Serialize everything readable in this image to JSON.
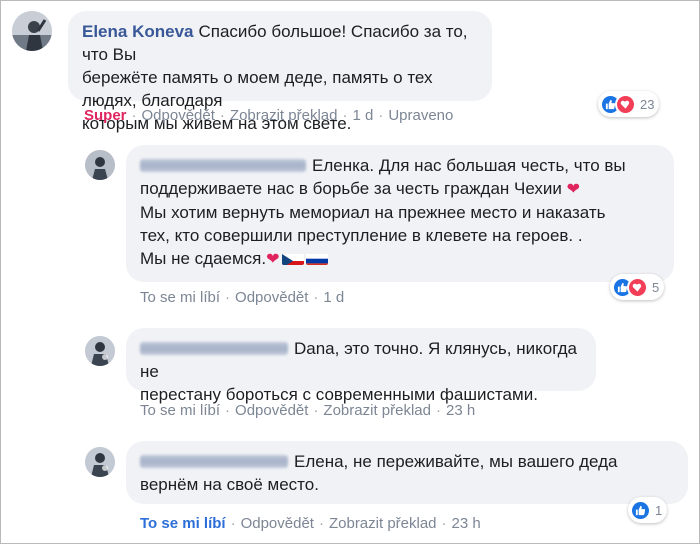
{
  "comments": [
    {
      "author": "Elena Koneva",
      "text_lines": [
        "Спасибо большое! Спасибо за то, что Вы",
        "бережёте память о моем деде, память о тех людях, благодаря",
        "которым мы живем на этом свете."
      ],
      "actions": [
        "Super",
        "Odpovědět",
        "Zobrazit překlad",
        "1 d",
        "Upraveno"
      ],
      "reactions": {
        "count": "23",
        "types": [
          "like-icon",
          "love-icon"
        ]
      }
    },
    {
      "author_hidden": true,
      "text_lines": [
        "Еленка. Для нас большая честь, что вы",
        "поддерживаете нас в борьбе за честь граждан Чехии",
        "Мы хотим вернуть мемориал на прежнее место и наказать",
        "тех, кто совершили преступление в клевете на героев. .",
        "Мы не сдаемся."
      ],
      "actions": [
        "To se mi líbí",
        "Odpovědět",
        "1 d"
      ],
      "reactions": {
        "count": "5",
        "types": [
          "like-icon",
          "love-icon"
        ]
      }
    },
    {
      "author_hidden": true,
      "text_lines": [
        "Dana, это точно. Я клянусь, никогда не",
        "перестану бороться с современными фашистами."
      ],
      "actions": [
        "To se mi líbí",
        "Odpovědět",
        "Zobrazit překlad",
        "23 h"
      ]
    },
    {
      "author_hidden": true,
      "text_lines": [
        "Елена, не переживайте, мы вашего деда",
        "вернём на своё место."
      ],
      "actions": [
        "To se mi líbí",
        "Odpovědět",
        "Zobrazit překlad",
        "23 h"
      ],
      "reactions": {
        "count": "1",
        "types": [
          "like-icon"
        ]
      }
    }
  ],
  "colors": {
    "link": "#385898",
    "super": "#e0245e",
    "liked": "#2d6fd8",
    "bubble": "#f0f2f5",
    "meta": "#7c8694"
  }
}
